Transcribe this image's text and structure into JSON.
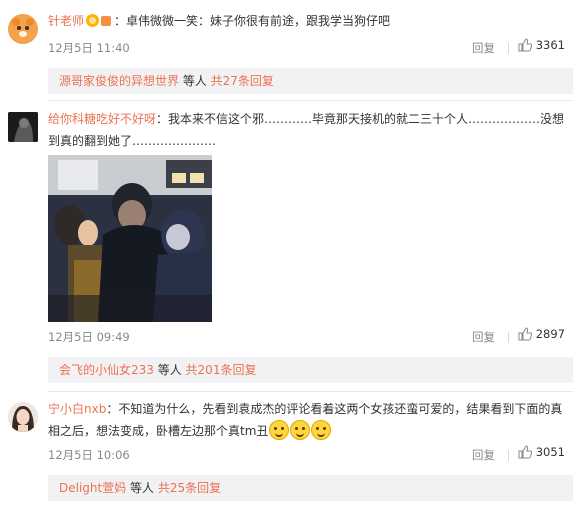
{
  "comments": [
    {
      "username": "针老师",
      "text": "：卓伟微微一笑：妹子你很有前途，跟我学当狗仔吧",
      "date": "12月5日 11:40",
      "reply_label": "回复",
      "likes": "3361",
      "sub": {
        "user": "源哥家俊俊的异想世界",
        "middle": " 等人 ",
        "count_link": "共27条回复"
      }
    },
    {
      "username": "给你科糖吃好不好呀",
      "text": "：我本来不信这个邪…………毕竟那天接机的就二三十个人………………没想到真的翻到她了…………………",
      "date": "12月5日 09:49",
      "reply_label": "回复",
      "likes": "2897",
      "sub": {
        "user": "会飞的小仙女233",
        "middle": " 等人 ",
        "count_link": "共201条回复"
      }
    },
    {
      "username": "宁小白nxb",
      "text": "：不知道为什么，先看到袁成杰的评论看着这两个女孩还蛮可爱的，结果看到下面的真相之后，想法变成，卧槽左边那个真tm丑",
      "date": "12月5日 10:06",
      "reply_label": "回复",
      "likes": "3051",
      "sub": {
        "user": "Delight萱妈",
        "middle": " 等人 ",
        "count_link": "共25条回复"
      }
    }
  ],
  "icons": {
    "vip_badge": "vip-badge-icon",
    "thumb": "thumb-up-icon",
    "emoji": "laughing-emoji-icon"
  },
  "colors": {
    "username": "#eb7350",
    "meta": "#888888",
    "subbar_bg": "#f2f2f5"
  }
}
